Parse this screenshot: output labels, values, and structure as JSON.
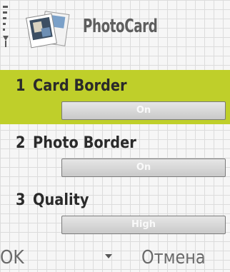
{
  "header": {
    "title": "PhotoCard",
    "icon": "photo-card-icon",
    "status_icon": "signal-strength-icon"
  },
  "settings": {
    "items": [
      {
        "number": "1",
        "label": "Card Border",
        "value": "On",
        "selected": true
      },
      {
        "number": "2",
        "label": "Photo Border",
        "value": "On",
        "selected": false
      },
      {
        "number": "3",
        "label": "Quality",
        "value": "High",
        "selected": false
      }
    ]
  },
  "softkeys": {
    "left": "OK",
    "middle_icon": "down-arrow-icon",
    "right": "Отмена"
  },
  "colors": {
    "highlight": "#bfcf2a",
    "grid_background": "#f6f6f6"
  }
}
